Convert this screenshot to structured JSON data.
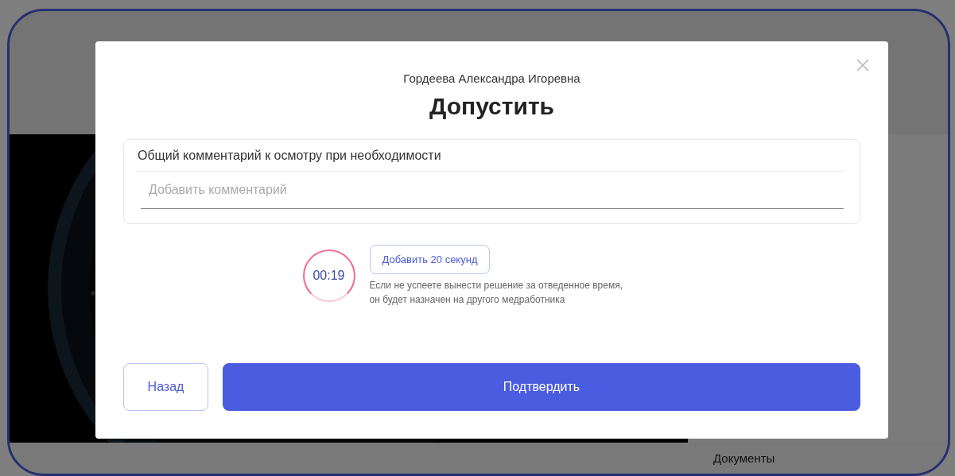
{
  "background": {
    "documents_label": "Документы"
  },
  "dialog": {
    "patient_name": "Гордеева Александра Игоревна",
    "title": "Допустить",
    "comment": {
      "label": "Общий комментарий к осмотру при необходимости",
      "placeholder": "Добавить комментарий"
    },
    "timer": {
      "time": "00:19",
      "add_button": "Добавить 20 секунд",
      "note": "Если не успеете вынести решение за отведенное время, он будет назначен на другого медработника"
    },
    "buttons": [
      {
        "label": "Назад",
        "kind": "secondary"
      },
      {
        "label": "Подтвердить",
        "kind": "primary"
      }
    ]
  }
}
